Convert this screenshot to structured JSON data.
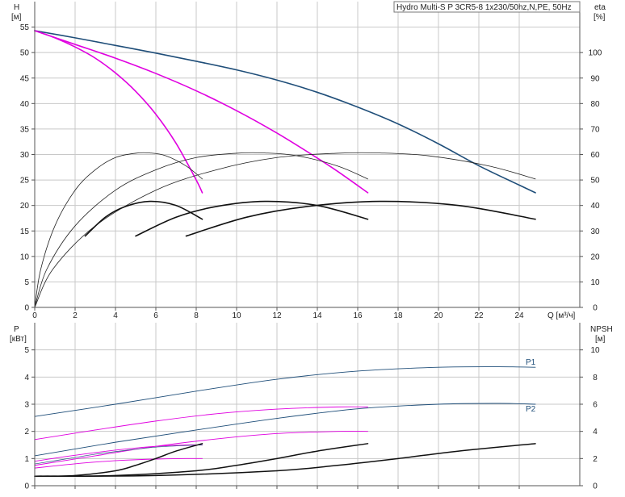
{
  "chart_data": [
    {
      "id": "top",
      "type": "line",
      "title": "Hydro Multi-S P 3CR5-8 1x230/50hz,N,PE, 50Hz",
      "ylabel": "H",
      "yunit": "[м]",
      "y2label": "eta",
      "y2unit": "[%]",
      "xlabel": "Q [м³/ч]",
      "xlim": [
        0,
        27
      ],
      "ylim": [
        0,
        60
      ],
      "y2lim": [
        0,
        120
      ],
      "xticks": [
        0,
        2,
        4,
        6,
        8,
        10,
        12,
        14,
        16,
        18,
        20,
        22,
        24
      ],
      "yticks": [
        0,
        5,
        10,
        15,
        20,
        25,
        30,
        35,
        40,
        45,
        50,
        55
      ],
      "y2ticks": [
        0,
        10,
        20,
        30,
        40,
        50,
        60,
        70,
        80,
        90,
        100
      ],
      "grid": true,
      "series": [
        {
          "axis": "y",
          "color": "#1f4e79",
          "width": 1.6,
          "x": [
            0,
            2,
            4,
            6,
            8,
            10,
            12,
            14,
            16,
            18,
            20,
            22,
            24,
            24.8
          ],
          "y": [
            54.3,
            52.9,
            51.4,
            49.9,
            48.3,
            46.6,
            44.6,
            42.2,
            39.3,
            36,
            32.1,
            27.8,
            24,
            22.5
          ]
        },
        {
          "axis": "y",
          "color": "#e000e0",
          "width": 1.6,
          "x": [
            0,
            2,
            4,
            6,
            8,
            10,
            12,
            14,
            15,
            16.5
          ],
          "y": [
            54.3,
            51.6,
            48.9,
            45.9,
            42.5,
            38.6,
            34.2,
            29.3,
            26.7,
            22.5
          ]
        },
        {
          "axis": "y",
          "color": "#e000e0",
          "width": 1.6,
          "x": [
            0,
            1,
            2,
            3,
            4,
            5,
            6,
            7,
            8,
            8.3
          ],
          "y": [
            54.3,
            52.9,
            51.1,
            48.9,
            46,
            42.4,
            37.9,
            32.2,
            25,
            22.5
          ]
        },
        {
          "axis": "y2",
          "color": "#222222",
          "width": 0.8,
          "x": [
            0,
            0.3,
            1,
            2,
            3,
            4,
            5,
            5.7,
            6.5,
            7.5,
            8.3
          ],
          "y": [
            0,
            15,
            32,
            46,
            54,
            58.8,
            60.5,
            60.6,
            59.5,
            55.5,
            50.4
          ]
        },
        {
          "axis": "y2",
          "color": "#222222",
          "width": 0.8,
          "x": [
            0,
            0.6,
            2,
            4,
            6,
            8,
            10,
            11.4,
            13,
            15,
            16.5
          ],
          "y": [
            0,
            15,
            32,
            46,
            54,
            58.8,
            60.5,
            60.6,
            59.5,
            55.5,
            50.4
          ]
        },
        {
          "axis": "y2",
          "color": "#222222",
          "width": 0.8,
          "x": [
            0,
            0.9,
            3,
            6,
            9,
            12,
            15,
            17.1,
            19.5,
            22.5,
            24.8
          ],
          "y": [
            0,
            15,
            32,
            46,
            54,
            58.8,
            60.5,
            60.6,
            59.5,
            55.5,
            50.4
          ]
        },
        {
          "axis": "y",
          "color": "#111111",
          "width": 1.6,
          "x": [
            2.5,
            3.5,
            4.5,
            5.7,
            7,
            8.3
          ],
          "y": [
            14,
            17.7,
            19.8,
            20.8,
            20,
            17.3
          ]
        },
        {
          "axis": "y",
          "color": "#111111",
          "width": 1.6,
          "x": [
            5,
            7,
            9,
            11.4,
            14,
            16.5
          ],
          "y": [
            14,
            17.7,
            19.8,
            20.8,
            20,
            17.3
          ]
        },
        {
          "axis": "y",
          "color": "#111111",
          "width": 1.6,
          "x": [
            7.5,
            10.5,
            13.5,
            17.1,
            21,
            24.8
          ],
          "y": [
            14,
            17.7,
            19.8,
            20.8,
            20,
            17.3
          ]
        }
      ]
    },
    {
      "id": "bottom",
      "type": "line",
      "ylabel": "P",
      "yunit": "[кВт]",
      "y2label": "NPSH",
      "y2unit": "[м]",
      "xlim": [
        0,
        27
      ],
      "ylim": [
        0,
        6
      ],
      "y2lim": [
        0,
        12
      ],
      "xticks": [
        0,
        2,
        4,
        6,
        8,
        10,
        12,
        14,
        16,
        18,
        20,
        22,
        24
      ],
      "yticks": [
        0,
        1,
        2,
        3,
        4,
        5
      ],
      "y2ticks": [
        0,
        2,
        4,
        6,
        8,
        10
      ],
      "grid": true,
      "series": [
        {
          "axis": "y",
          "color": "#1f4e79",
          "width": 0.9,
          "label": "P1",
          "x": [
            0,
            4,
            8,
            12,
            16,
            20,
            23,
            24.8
          ],
          "y": [
            2.55,
            3.0,
            3.48,
            3.92,
            4.22,
            4.36,
            4.38,
            4.36
          ]
        },
        {
          "axis": "y",
          "color": "#1f4e79",
          "width": 0.9,
          "label": "P2",
          "x": [
            0,
            4,
            8,
            12,
            16,
            20,
            23,
            24.8
          ],
          "y": [
            1.1,
            1.6,
            2.05,
            2.48,
            2.83,
            3.0,
            3.03,
            3.0
          ]
        },
        {
          "axis": "y",
          "color": "#e000e0",
          "width": 0.9,
          "x": [
            0,
            3,
            6,
            9,
            12,
            15,
            16.5
          ],
          "y": [
            1.7,
            2.05,
            2.38,
            2.65,
            2.82,
            2.9,
            2.9
          ]
        },
        {
          "axis": "y",
          "color": "#e000e0",
          "width": 0.9,
          "x": [
            0,
            3,
            6,
            9,
            12,
            15,
            16.5
          ],
          "y": [
            0.75,
            1.1,
            1.45,
            1.72,
            1.92,
            2.0,
            2.0
          ]
        },
        {
          "axis": "y",
          "color": "#e000e0",
          "width": 0.9,
          "x": [
            0,
            1.5,
            3,
            4.5,
            6,
            7.5,
            8.3
          ],
          "y": [
            0.9,
            1.07,
            1.22,
            1.35,
            1.45,
            1.5,
            1.5
          ]
        },
        {
          "axis": "y",
          "color": "#e000e0",
          "width": 0.9,
          "x": [
            0,
            1.5,
            3,
            4.5,
            6,
            7.5,
            8.3
          ],
          "y": [
            0.65,
            0.77,
            0.87,
            0.94,
            0.98,
            1.0,
            1.0
          ]
        },
        {
          "axis": "y",
          "color": "#1f4e79",
          "width": 0.7,
          "x": [
            0,
            1.5,
            3,
            4.5,
            6,
            7.5,
            8.3
          ],
          "y": [
            0.8,
            0.98,
            1.16,
            1.3,
            1.42,
            1.48,
            1.5
          ]
        },
        {
          "axis": "y2",
          "color": "#111111",
          "width": 1.5,
          "x": [
            0,
            2,
            4,
            5,
            6,
            7,
            8.3
          ],
          "y": [
            0.7,
            0.75,
            1.1,
            1.5,
            2.0,
            2.55,
            3.1
          ]
        },
        {
          "axis": "y2",
          "color": "#111111",
          "width": 1.5,
          "x": [
            0,
            4,
            8,
            10,
            12,
            14,
            16.5
          ],
          "y": [
            0.7,
            0.75,
            1.1,
            1.5,
            2.0,
            2.55,
            3.1
          ]
        },
        {
          "axis": "y2",
          "color": "#111111",
          "width": 1.5,
          "x": [
            0,
            6,
            12,
            15,
            18,
            21,
            24.8
          ],
          "y": [
            0.7,
            0.75,
            1.1,
            1.5,
            2.0,
            2.55,
            3.1
          ]
        }
      ]
    }
  ]
}
